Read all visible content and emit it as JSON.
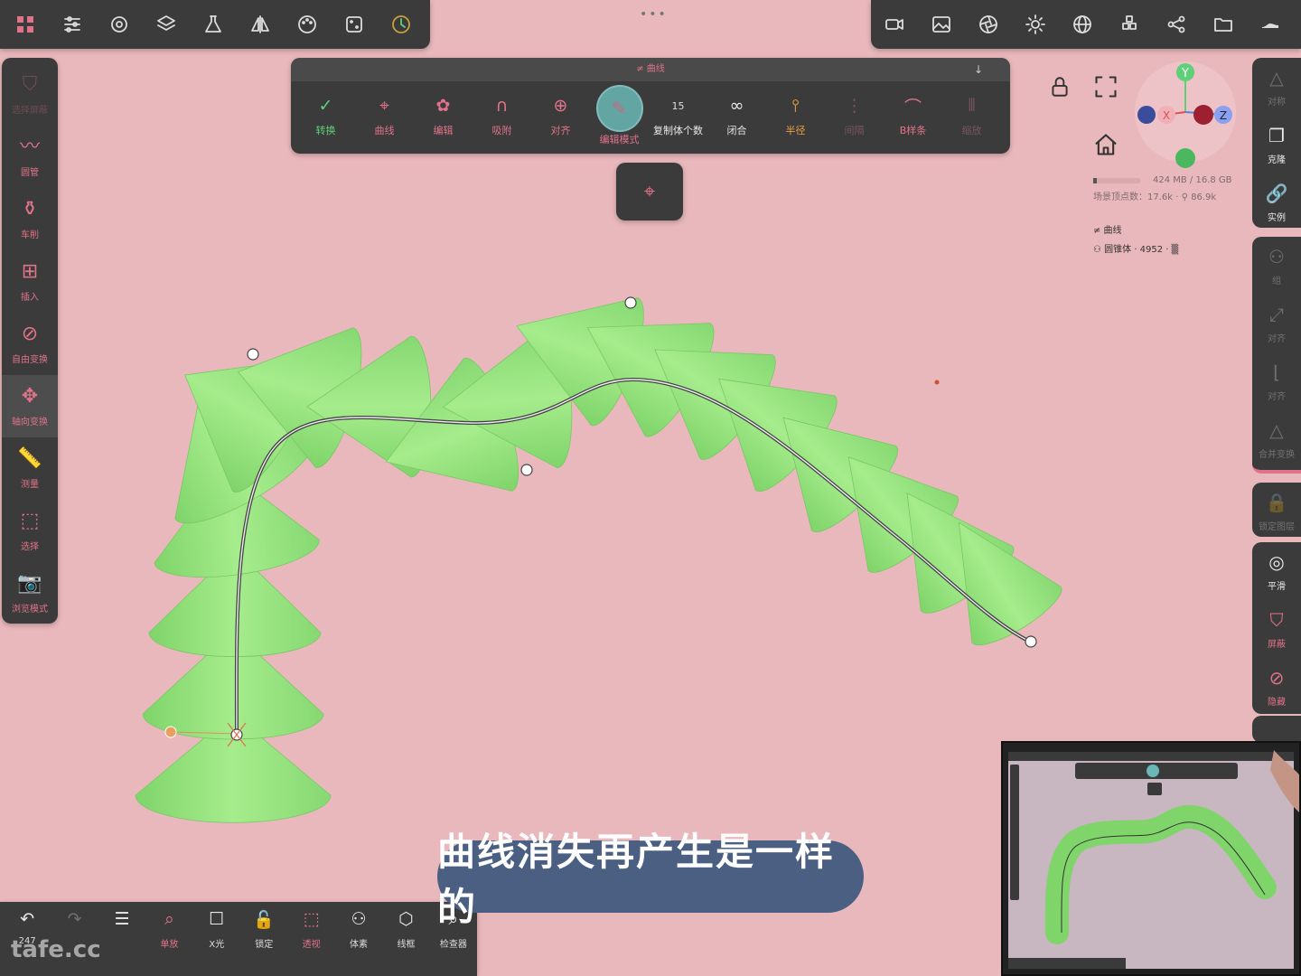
{
  "top_toolbar_left": {
    "icons": [
      "grid-logo-icon",
      "sliders-icon",
      "gear-icon",
      "layers-icon",
      "flask-icon",
      "mirror-icon",
      "palette-icon",
      "dice-icon",
      "axis-clock-icon"
    ]
  },
  "top_toolbar_right": {
    "icons": [
      "video-icon",
      "image-icon",
      "aperture-icon",
      "sun-icon",
      "sphere-grid-icon",
      "voxels-icon",
      "share-nodes-icon",
      "folder-icon",
      "shoe-icon"
    ]
  },
  "curve_toolbar": {
    "title": "≠ 曲线",
    "tools": [
      {
        "label": "转换",
        "glyph": "✓",
        "color": "green"
      },
      {
        "label": "曲线",
        "glyph": "⌖",
        "color": "pink"
      },
      {
        "label": "编辑",
        "glyph": "✿",
        "color": "pink"
      },
      {
        "label": "吸附",
        "glyph": "∩",
        "color": "pink"
      },
      {
        "label": "对齐",
        "glyph": "⊕",
        "color": "pink"
      },
      {
        "label": "编辑模式",
        "glyph": "✎",
        "color": "pink"
      },
      {
        "label": "复制体个数",
        "value": "15",
        "color": "white"
      },
      {
        "label": "闭合",
        "glyph": "∞",
        "color": "white"
      },
      {
        "label": "半径",
        "glyph": "⫯",
        "color": "orange"
      },
      {
        "label": "间隔",
        "glyph": "⋮",
        "color": "dim"
      },
      {
        "label": "B样条",
        "glyph": "⌒",
        "color": "pink"
      },
      {
        "label": "缩放",
        "glyph": "⦀",
        "color": "dim"
      }
    ]
  },
  "left_sidebar": [
    {
      "label": "选择屏蔽",
      "glyph": "⛉",
      "faded": true
    },
    {
      "label": "圆管",
      "glyph": "〰"
    },
    {
      "label": "车削",
      "glyph": "⚱"
    },
    {
      "label": "插入",
      "glyph": "⊞"
    },
    {
      "label": "自由变换",
      "glyph": "⊘"
    },
    {
      "label": "轴向变换",
      "glyph": "✥",
      "selected": true
    },
    {
      "label": "测量",
      "glyph": "📏"
    },
    {
      "label": "选择",
      "glyph": "⬚"
    },
    {
      "label": "浏览模式",
      "glyph": "📷"
    }
  ],
  "right_sidebar": {
    "group1": [
      {
        "label": "对称",
        "glyph": "△",
        "faded": true
      },
      {
        "label": "克隆",
        "glyph": "❐"
      },
      {
        "label": "实例",
        "glyph": "🔗"
      }
    ],
    "group2": [
      {
        "label": "组",
        "glyph": "⚇",
        "faded": true
      },
      {
        "label": "对齐",
        "glyph": "⤢",
        "faded": true
      },
      {
        "label": "对齐",
        "glyph": "⌊",
        "faded": true
      },
      {
        "label": "合并变换",
        "glyph": "△",
        "faded": true
      }
    ],
    "group3": [
      {
        "label": "锁定图层",
        "glyph": "🔒",
        "faded": true
      }
    ],
    "group4": [
      {
        "label": "平滑",
        "glyph": "◎"
      },
      {
        "label": "屏蔽",
        "glyph": "⛉",
        "pink": true
      },
      {
        "label": "隐藏",
        "glyph": "⊘",
        "pink": true
      }
    ]
  },
  "info": {
    "memory": "424 MB / 16.8 GB",
    "stats": "场景顶点数：17.6k · ⚲ 86.9k",
    "objects": [
      "≠ 曲线",
      "⚇ 圆锥体 · 4952 · ▒"
    ]
  },
  "gizmo": {
    "y": "Y",
    "x": "X",
    "z": "Z"
  },
  "bottom_bar": [
    {
      "label": "247",
      "glyph": "↶"
    },
    {
      "label": "",
      "glyph": "↷",
      "faded": true
    },
    {
      "label": "",
      "glyph": "☰"
    },
    {
      "label": "单放",
      "glyph": "⌕",
      "pink": true
    },
    {
      "label": "X光",
      "glyph": "☐"
    },
    {
      "label": "锁定",
      "glyph": "🔓"
    },
    {
      "label": "透视",
      "glyph": "⬚",
      "pink": true
    },
    {
      "label": "体素",
      "glyph": "⚇"
    },
    {
      "label": "线框",
      "glyph": "⬡"
    },
    {
      "label": "检查器",
      "glyph": "⌕"
    }
  ],
  "watermark": "tafe.cc",
  "subtitle": "曲线消失再产生是一样的",
  "top_dots": "•••",
  "colors": {
    "background": "#e9b8bc",
    "panel": "#3b3b3b",
    "accent": "#e0738a",
    "cone": "#95e27e"
  }
}
